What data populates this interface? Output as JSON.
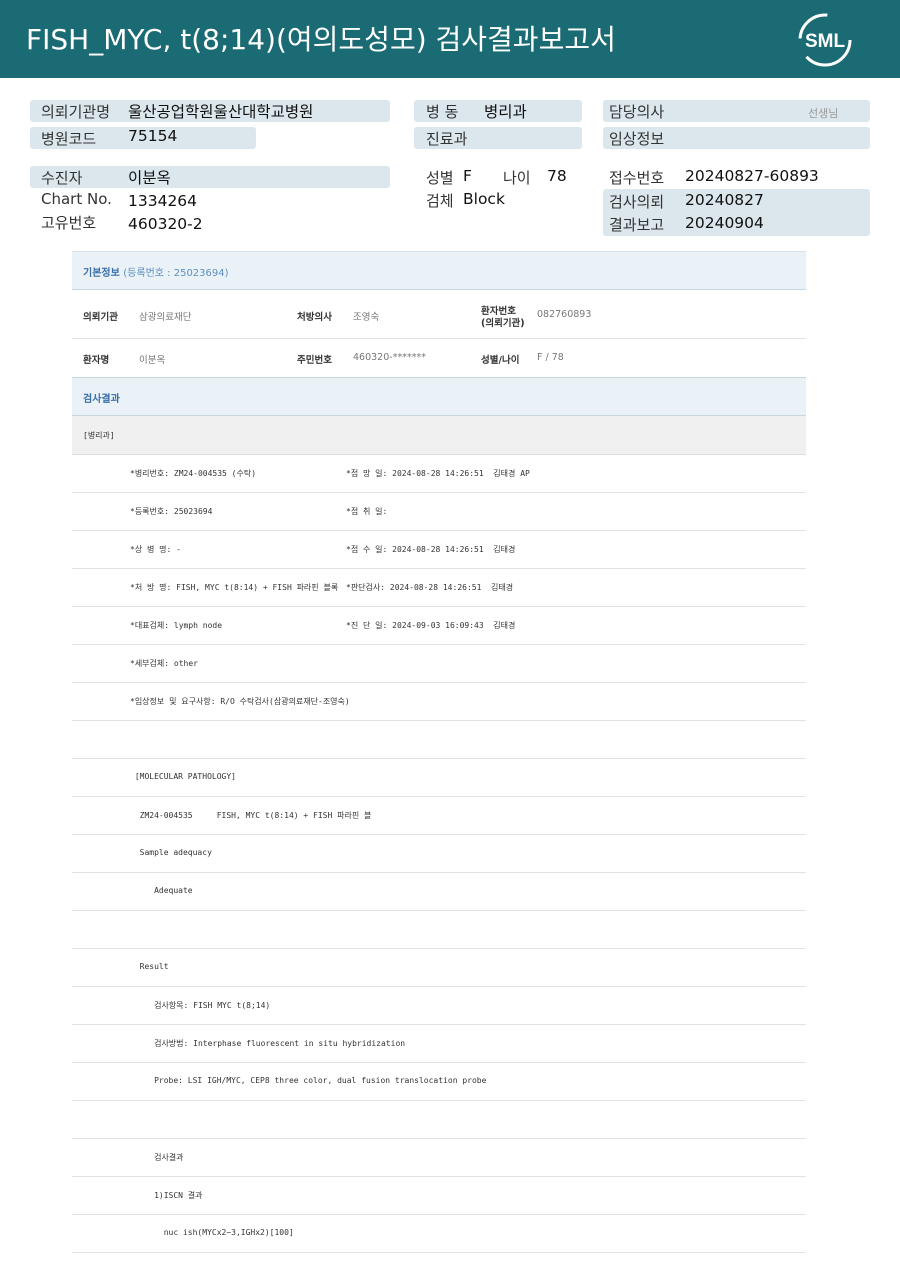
{
  "banner": {
    "title": "FISH_MYC, t(8;14)(여의도성모) 검사결과보고서",
    "logo_text": "SML"
  },
  "header": {
    "org_label": "의뢰기관명",
    "org_value": "울산공업학원울산대학교병원",
    "code_label": "병원코드",
    "code_value": "75154",
    "ward_label": "병 동",
    "ward_value": "병리과",
    "dept_label": "진료과",
    "doctor_label": "담당의사",
    "doctor_suffix": "선생님",
    "clinical_label": "임상정보",
    "patient_label": "수진자",
    "patient_value": "이분옥",
    "chart_label": "Chart No.",
    "chart_value": "1334264",
    "id_label": "고유번호",
    "id_value": "460320-2",
    "sex_label": "성별",
    "sex_value": "F",
    "age_label": "나이",
    "age_value": "78",
    "specimen_label": "검체",
    "specimen_value": "Block",
    "receipt_label": "접수번호",
    "receipt_value": "20240827-60893",
    "request_label": "검사의뢰",
    "request_value": "20240827",
    "result_label": "결과보고",
    "result_value": "20240904"
  },
  "basic_info": {
    "title": "기본정보",
    "reg_text": "(등록번호 : 25023694)",
    "org_k": "의뢰기관",
    "org_v": "삼광의료재단",
    "doc_k": "처방의사",
    "doc_v": "조영숙",
    "pno_k1": "환자번호",
    "pno_k2": "(의뢰기관)",
    "pno_v": "082760893",
    "name_k": "환자명",
    "name_v": "이분옥",
    "rrn_k": "주민번호",
    "rrn_v": "460320-*******",
    "sexage_k": "성별/나이",
    "sexage_v": "F / 78"
  },
  "results": {
    "title": "검사결과",
    "dept_tag": "[병리과]",
    "lines": [
      {
        "text": "*병리번호: ZM24-004535 (수탁)",
        "right": "*접 망 일: 2024-08-28 14:26:51  김태경 AP"
      },
      {
        "text": "*등록번호: 25023694",
        "right": "*접 취 일:"
      },
      {
        "text": "*상 병 명: -",
        "right": "*접 수 일: 2024-08-28 14:26:51  김태경"
      },
      {
        "text": "*처 방 명: FISH, MYC t(8:14) + FISH 파라핀 블록",
        "right": "*판단검사: 2024-08-28 14:26:51  김태경"
      },
      {
        "text": "*대표검체: lymph node",
        "right": "*진 단 일: 2024-09-03 16:09:43  김태경"
      },
      {
        "text": "*세부검체: other",
        "right": ""
      },
      {
        "text": "*임상정보 및 요구사항: R/O 수탁검사(삼광의료재단-조영숙)",
        "right": ""
      },
      {
        "text": "",
        "right": ""
      },
      {
        "text": " [MOLECULAR PATHOLOGY]",
        "right": ""
      },
      {
        "text": "  ZM24-004535     FISH, MYC t(8:14) + FISH 파라핀 블",
        "right": ""
      },
      {
        "text": "  Sample adequacy",
        "right": ""
      },
      {
        "text": "     Adequate",
        "right": ""
      },
      {
        "text": "",
        "right": ""
      },
      {
        "text": "  Result",
        "right": ""
      },
      {
        "text": "     검사항목: FISH MYC t(8;14)",
        "right": ""
      },
      {
        "text": "     검사방법: Interphase fluorescent in situ hybridization",
        "right": ""
      },
      {
        "text": "     Probe: LSI IGH/MYC, CEP8 three color, dual fusion translocation probe",
        "right": ""
      },
      {
        "text": "",
        "right": ""
      },
      {
        "text": "     검사결과",
        "right": ""
      },
      {
        "text": "     1)ISCN 결과",
        "right": ""
      },
      {
        "text": "       nuc ish(MYCx2~3,IGHx2)[100]",
        "right": ""
      }
    ]
  },
  "colors": {
    "banner": "#1b6b74",
    "label_bg": "#dbe7ed",
    "section_head": "#eaf2f8",
    "accent_text": "#3b6fa8"
  }
}
